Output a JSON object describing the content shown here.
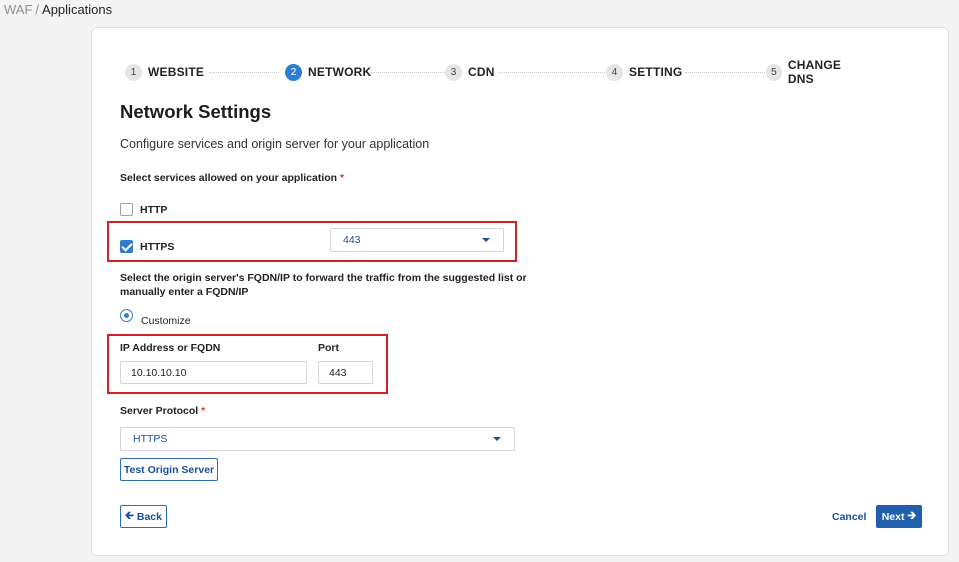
{
  "breadcrumb": {
    "root": "WAF",
    "separator": "/",
    "current": "Applications"
  },
  "steps": [
    {
      "num": "1",
      "label": "WEBSITE",
      "active": false
    },
    {
      "num": "2",
      "label": "NETWORK",
      "active": true
    },
    {
      "num": "3",
      "label": "CDN",
      "active": false
    },
    {
      "num": "4",
      "label": "SETTING",
      "active": false
    },
    {
      "num": "5",
      "label": "CHANGE DNS",
      "active": false
    }
  ],
  "page": {
    "title": "Network Settings",
    "subtitle": "Configure services and origin server for your application"
  },
  "services": {
    "label": "Select services allowed on your application",
    "required_mark": "*",
    "http": {
      "label": "HTTP",
      "checked": false
    },
    "https": {
      "label": "HTTPS",
      "checked": true,
      "port_selected": "443"
    }
  },
  "origin": {
    "label_line1": "Select the origin server's FQDN/IP to forward the traffic from the suggested list or",
    "label_line2": "manually enter a FQDN/IP",
    "option": "Customize",
    "ip_label": "IP Address or FQDN",
    "ip_value": "10.10.10.10",
    "port_label": "Port",
    "port_value": "443"
  },
  "protocol": {
    "label": "Server Protocol",
    "required_mark": "*",
    "selected": "HTTPS"
  },
  "buttons": {
    "test_origin": "Test Origin Server",
    "back": "Back",
    "cancel": "Cancel",
    "next": "Next"
  },
  "colors": {
    "accent": "#2f7dd1",
    "primary_button": "#1f5fae",
    "highlight": "#d1232a",
    "required": "#d23b2f"
  }
}
